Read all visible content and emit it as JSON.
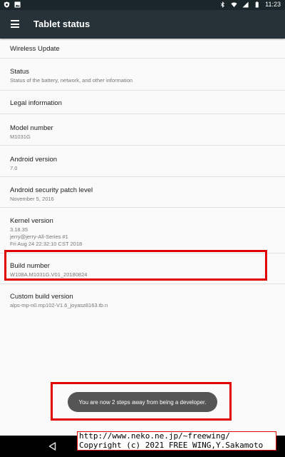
{
  "status_bar": {
    "time": "11:23",
    "left_icons": [
      "shield-icon",
      "image-icon"
    ],
    "right_icons": [
      "bluetooth-icon",
      "wifi-icon",
      "signal-icon",
      "battery-icon"
    ]
  },
  "app_bar": {
    "title": "Tablet status",
    "menu_icon": "hamburger-menu-icon"
  },
  "items": [
    {
      "title": "Wireless Update",
      "summary": ""
    },
    {
      "title": "Status",
      "summary": "Status of the battery, network, and other information"
    },
    {
      "title": "Legal information",
      "summary": ""
    },
    {
      "title": "Model number",
      "summary": "M1031G"
    },
    {
      "title": "Android version",
      "summary": "7.0"
    },
    {
      "title": "Android security patch level",
      "summary": "November 5, 2016"
    },
    {
      "title": "Kernel version",
      "summary": "3.18.35\njerry@jerry-All-Series #1\nFri Aug 24 22:32:10 CST 2018"
    },
    {
      "title": "Build number",
      "summary": "W108A.M1031G.V01_20180824"
    },
    {
      "title": "Custom build version",
      "summary": "alps-mp-n0.mp102-V1.6_joyasz8163.tb.n"
    }
  ],
  "toast": {
    "text": "You are now 2 steps away from being a developer."
  },
  "watermark": {
    "line1": "http://www.neko.ne.jp/~freewing/",
    "line2": "Copyright (c) 2021 FREE WING,Y.Sakamoto"
  },
  "colors": {
    "app_bar": "#263238",
    "status_bar": "#1b262b",
    "highlight_box": "#e00000",
    "toast_bg": "#555555"
  }
}
